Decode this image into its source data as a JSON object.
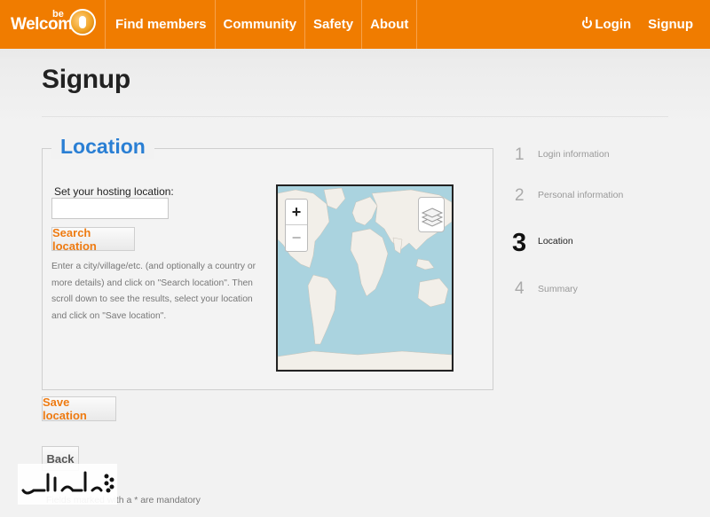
{
  "brand": {
    "logo_text": "Welcome",
    "logo_superscript": "be"
  },
  "nav": {
    "items": [
      "Find members",
      "Community",
      "Safety",
      "About"
    ],
    "login": "Login",
    "signup": "Signup"
  },
  "page": {
    "title": "Signup"
  },
  "location": {
    "legend": "Location",
    "field_label": "Set your hosting location:",
    "field_value": "",
    "search_button": "Search location",
    "help_text": "Enter a city/village/etc. (and optionally a country or more details) and click on \"Search location\". Then scroll down to see the results, select your location and click on \"Save location\"."
  },
  "map": {
    "zoom_in": "+",
    "zoom_out": "−",
    "layers_icon": "layers-icon"
  },
  "steps": [
    {
      "num": "1",
      "label": "Login information",
      "active": false
    },
    {
      "num": "2",
      "label": "Personal information",
      "active": false
    },
    {
      "num": "3",
      "label": "Location",
      "active": true
    },
    {
      "num": "4",
      "label": "Summary",
      "active": false
    }
  ],
  "actions": {
    "save": "Save location",
    "back": "Back"
  },
  "footer": {
    "mandatory": "Fields marked with a * are mandatory"
  },
  "colors": {
    "brand_orange": "#f07c00",
    "legend_blue": "#2a7fd4",
    "ocean": "#aad3df",
    "land": "#f2efe9"
  }
}
